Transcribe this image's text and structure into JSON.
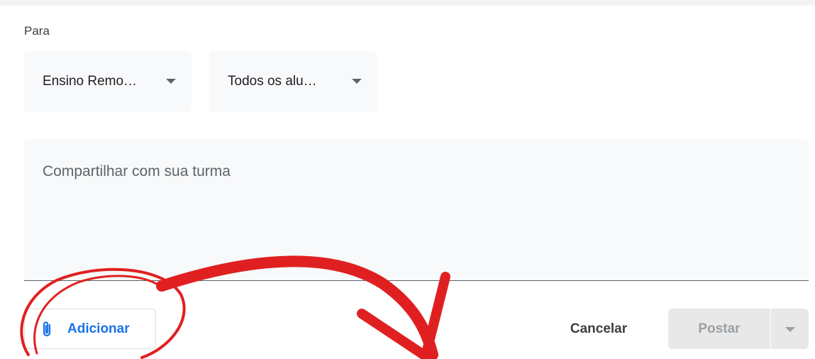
{
  "form": {
    "for_label": "Para",
    "class_dropdown": {
      "value": "Ensino Remo…"
    },
    "students_dropdown": {
      "value": "Todos os alu…"
    },
    "share_box": {
      "placeholder": "Compartilhar com sua turma"
    }
  },
  "actions": {
    "add_label": "Adicionar",
    "add_icon": "paperclip-icon",
    "cancel_label": "Cancelar",
    "post_label": "Postar",
    "post_menu_icon": "dropdown-arrow-icon"
  },
  "colors": {
    "accent_blue": "#1a73e8",
    "annotation_red": "#e02020",
    "disabled_text": "#9aa0a6",
    "field_background": "#f8f9fa"
  }
}
